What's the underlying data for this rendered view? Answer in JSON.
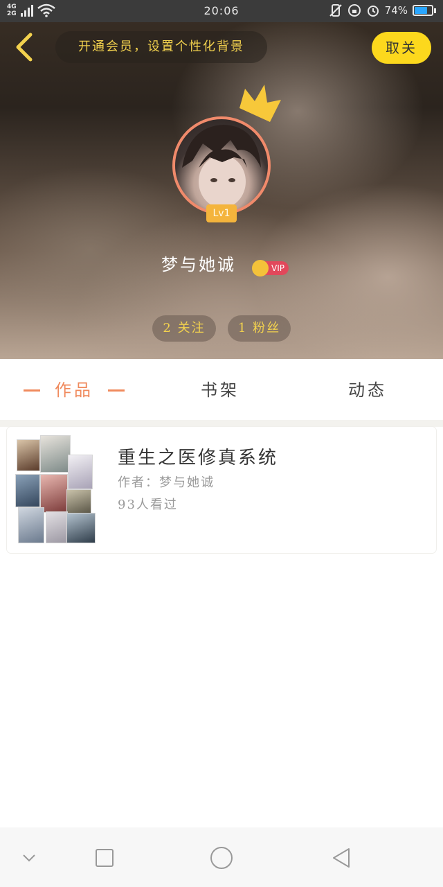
{
  "status_bar": {
    "network_top": "4G",
    "network_bottom": "2G",
    "time": "20:06",
    "battery_percent": "74%",
    "battery_level": 0.74,
    "icons": [
      "signal-icon",
      "wifi-icon",
      "vibrate-off-icon",
      "rotation-lock-icon",
      "alarm-icon",
      "battery-icon"
    ]
  },
  "header": {
    "back_icon": "chevron-left-icon",
    "vip_banner": "开通会员，设置个性化背景",
    "unfollow_label": "取关"
  },
  "profile": {
    "level": "Lv1",
    "username": "梦与她诚",
    "vip_label": "VIP",
    "follow_stat": "2 关注",
    "fans_stat": "1 粉丝"
  },
  "tabs": [
    {
      "label": "作品",
      "active": true
    },
    {
      "label": "书架",
      "active": false
    },
    {
      "label": "动态",
      "active": false
    }
  ],
  "works": [
    {
      "title": "重生之医修真系统",
      "author": "作者：梦与她诚",
      "views": "93人看过"
    }
  ],
  "colors": {
    "accent": "#f08a5d",
    "vip_yellow": "#fcd81d",
    "gold_text": "#f3d24e",
    "vip_red": "#e2485b"
  },
  "nav_bar": {
    "icons": [
      "chevron-down-icon",
      "square-icon",
      "circle-home-icon",
      "triangle-back-icon"
    ]
  }
}
